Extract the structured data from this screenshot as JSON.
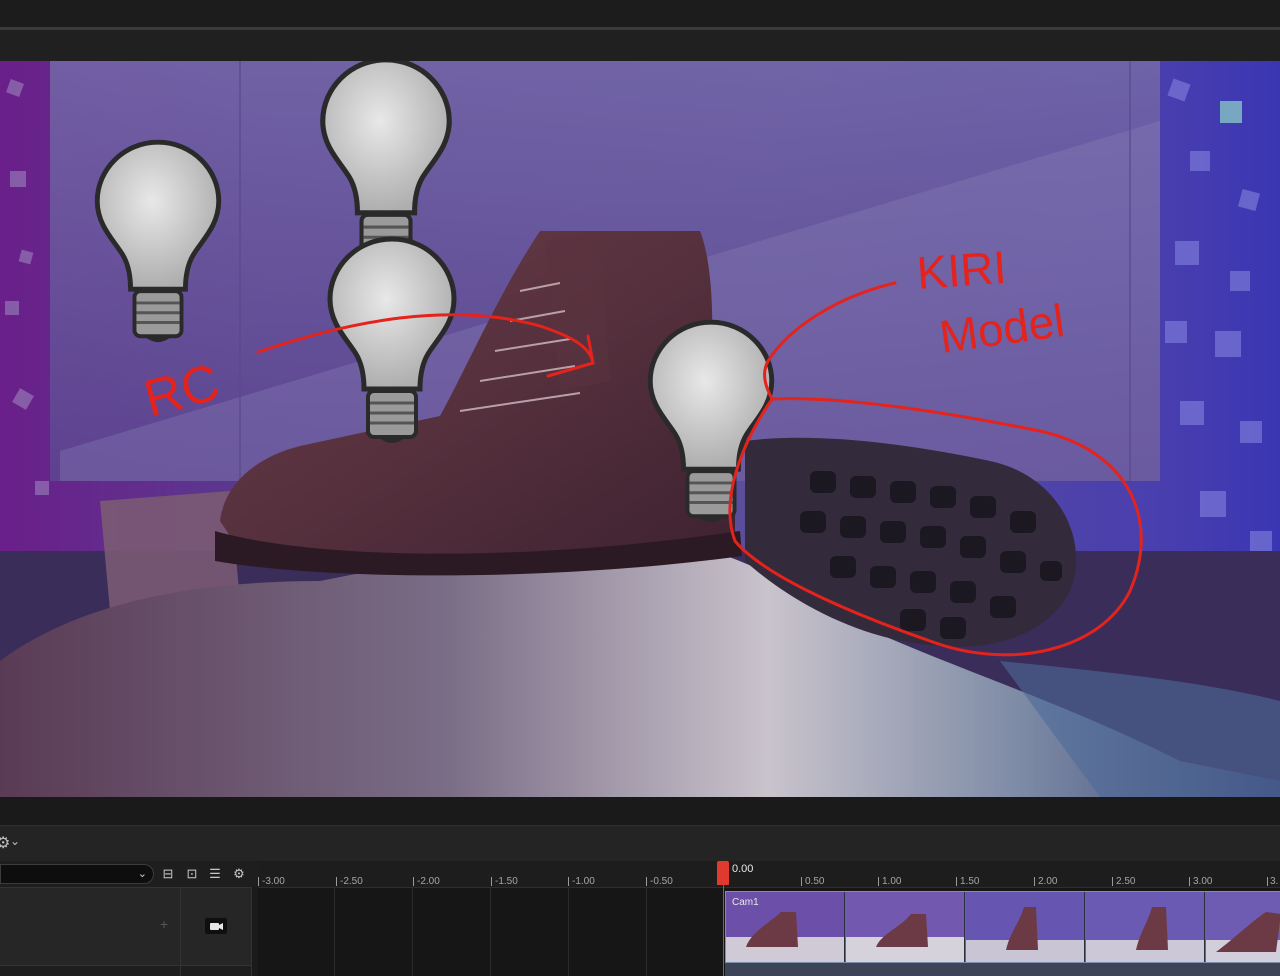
{
  "viewport": {
    "annotation_left": "RC",
    "annotation_right_line1": "KIRI",
    "annotation_right_line2": "Model"
  },
  "sequencer": {
    "search_placeholder": "",
    "track_chevron": "⌄",
    "settings_icon": "gear-icon",
    "ruler_labels": [
      "-3.00",
      "-2.50",
      "-2.00",
      "-1.50",
      "-1.00",
      "-0.50",
      "0.50",
      "1.00",
      "1.50",
      "2.00",
      "2.50",
      "3.00",
      "3."
    ],
    "playhead_time": "0.00",
    "clip_label": "Cam1"
  },
  "colors": {
    "annotation": "#e3231c",
    "playhead": "#e0392f",
    "clip": "#5a6c8c"
  }
}
